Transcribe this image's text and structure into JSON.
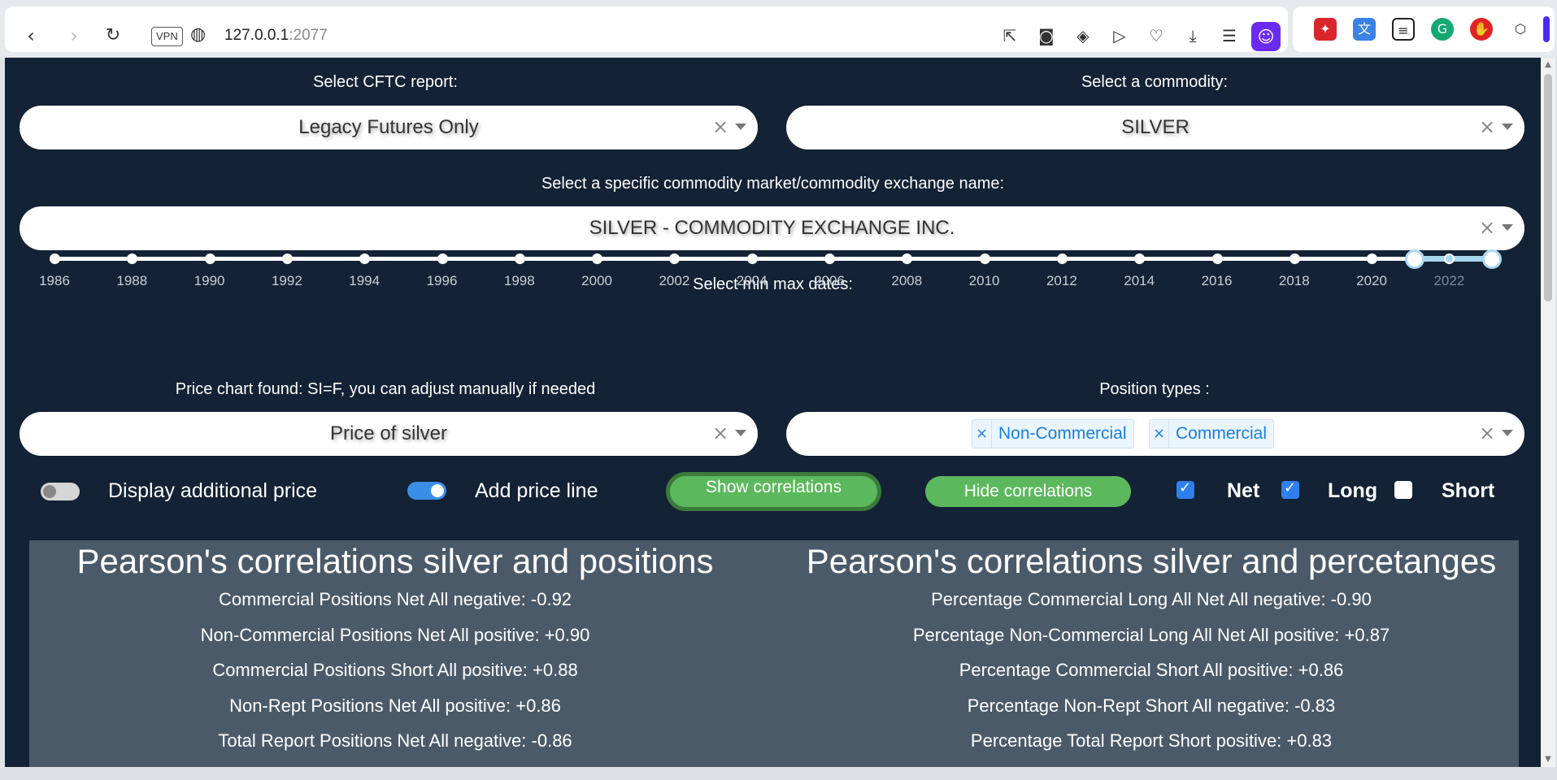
{
  "browser": {
    "back_icon": "arrow-left-icon",
    "forward_icon": "arrow-right-icon",
    "reload_icon": "reload-icon",
    "vpn_label": "VPN",
    "url_host": "127.0.0.1",
    "url_port": ":2077",
    "toolbar_icons": [
      "share-icon",
      "camera-icon",
      "shield-check-icon",
      "send-icon",
      "heart-icon",
      "download-icon",
      "settings-icon",
      "profile-icon"
    ],
    "extensions": [
      "magic-wand-icon",
      "translate-icon",
      "reader-icon",
      "grammarly-icon",
      "hand-icon",
      "cube-icon"
    ]
  },
  "report": {
    "label": "Select CFTC report:",
    "value": "Legacy Futures Only"
  },
  "commodity": {
    "label": "Select a commodity:",
    "value": "SILVER"
  },
  "market": {
    "label": "Select a specific commodity market/commodity exchange name:",
    "value": "SILVER - COMMODITY EXCHANGE INC."
  },
  "dates": {
    "label": "Select min max dates:",
    "years": [
      "1986",
      "1988",
      "1990",
      "1992",
      "1994",
      "1996",
      "1998",
      "2000",
      "2002",
      "2004",
      "2006",
      "2008",
      "2010",
      "2012",
      "2014",
      "2016",
      "2018",
      "2020",
      "2022"
    ],
    "range_start_fraction": 0.946,
    "range_end_fraction": 1.0
  },
  "price_chart": {
    "label": "Price chart found: SI=F, you can adjust manually if needed",
    "value": "Price of silver"
  },
  "position_types": {
    "label": "Position types :",
    "tags": [
      "Non-Commercial",
      "Commercial"
    ]
  },
  "controls": {
    "additional_price_label": "Display additional price",
    "additional_price_on": false,
    "price_line_label": "Add price line",
    "price_line_on": true,
    "show_corr_label": "Show correlations",
    "hide_corr_label": "Hide correlations",
    "net_label": "Net",
    "net_checked": true,
    "long_label": "Long",
    "long_checked": true,
    "short_label": "Short",
    "short_checked": false,
    "check_glyph": "✓"
  },
  "correlations": {
    "left_title": "Pearson's correlations silver and positions",
    "left_lines": [
      "Commercial Positions Net All negative: -0.92",
      "Non-Commercial Positions Net All positive: +0.90",
      "Commercial Positions Short All positive: +0.88",
      "Non-Rept Positions Net All positive: +0.86",
      "Total Report Positions Net All negative: -0.86"
    ],
    "right_title": "Pearson's correlations silver and percetanges",
    "right_lines": [
      "Percentage Commercial Long All Net All negative: -0.90",
      "Percentage Non-Commercial Long All Net All positive: +0.87",
      "Percentage Commercial Short All positive: +0.86",
      "Percentage Non-Rept Short All negative: -0.83",
      "Percentage Total Report Short positive: +0.83"
    ]
  },
  "colors": {
    "app_bg": "#132235",
    "panel_bg": "#4b5a69",
    "button_green": "#5cb85c",
    "toggle_on": "#3a8ee6",
    "tag_text": "#1a7fe0"
  }
}
